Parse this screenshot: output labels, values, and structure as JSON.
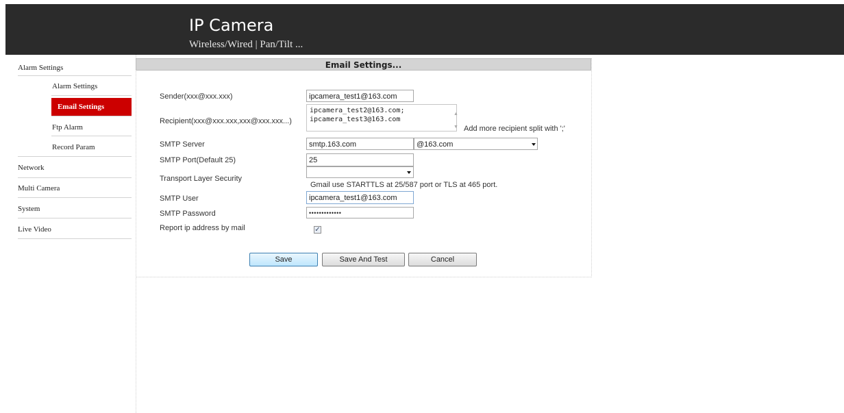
{
  "header": {
    "title": "IP Camera",
    "subtitle": "Wireless/Wired | Pan/Tilt ..."
  },
  "sidebar": {
    "alarm_settings": "Alarm Settings",
    "sub_items": [
      "Alarm Settings",
      "Email Settings",
      "Ftp Alarm",
      "Record Param"
    ],
    "active_sub": "Email Settings",
    "network": "Network",
    "multi_camera": "Multi Camera",
    "system": "System",
    "live_video": "Live Video"
  },
  "panel": {
    "title": "Email Settings..."
  },
  "form": {
    "sender_label": "Sender(xxx@xxx.xxx)",
    "sender_value": "ipcamera_test1@163.com",
    "recipient_label": "Recipient(xxx@xxx.xxx,xxx@xxx.xxx...)",
    "recipient_line1": "ipcamera_test2@163.com;",
    "recipient_line2": "ipcamera_test3@163.com",
    "recipient_hint": "Add more recipient split with ';'",
    "smtp_server_label": "SMTP Server",
    "smtp_server_value": "smtp.163.com",
    "smtp_server_select": "@163.com",
    "smtp_port_label": "SMTP Port(Default 25)",
    "smtp_port_value": "25",
    "tls_label": "Transport Layer Security",
    "tls_value": "",
    "tls_hint": "Gmail use STARTTLS at 25/587 port or TLS at 465 port.",
    "smtp_user_label": "SMTP User",
    "smtp_user_value": "ipcamera_test1@163.com",
    "smtp_password_label": "SMTP Password",
    "smtp_password_value": "•••••••••••••",
    "report_ip_label": "Report ip address by mail",
    "report_ip_checked": true
  },
  "buttons": {
    "save": "Save",
    "save_and_test": "Save And Test",
    "cancel": "Cancel"
  }
}
